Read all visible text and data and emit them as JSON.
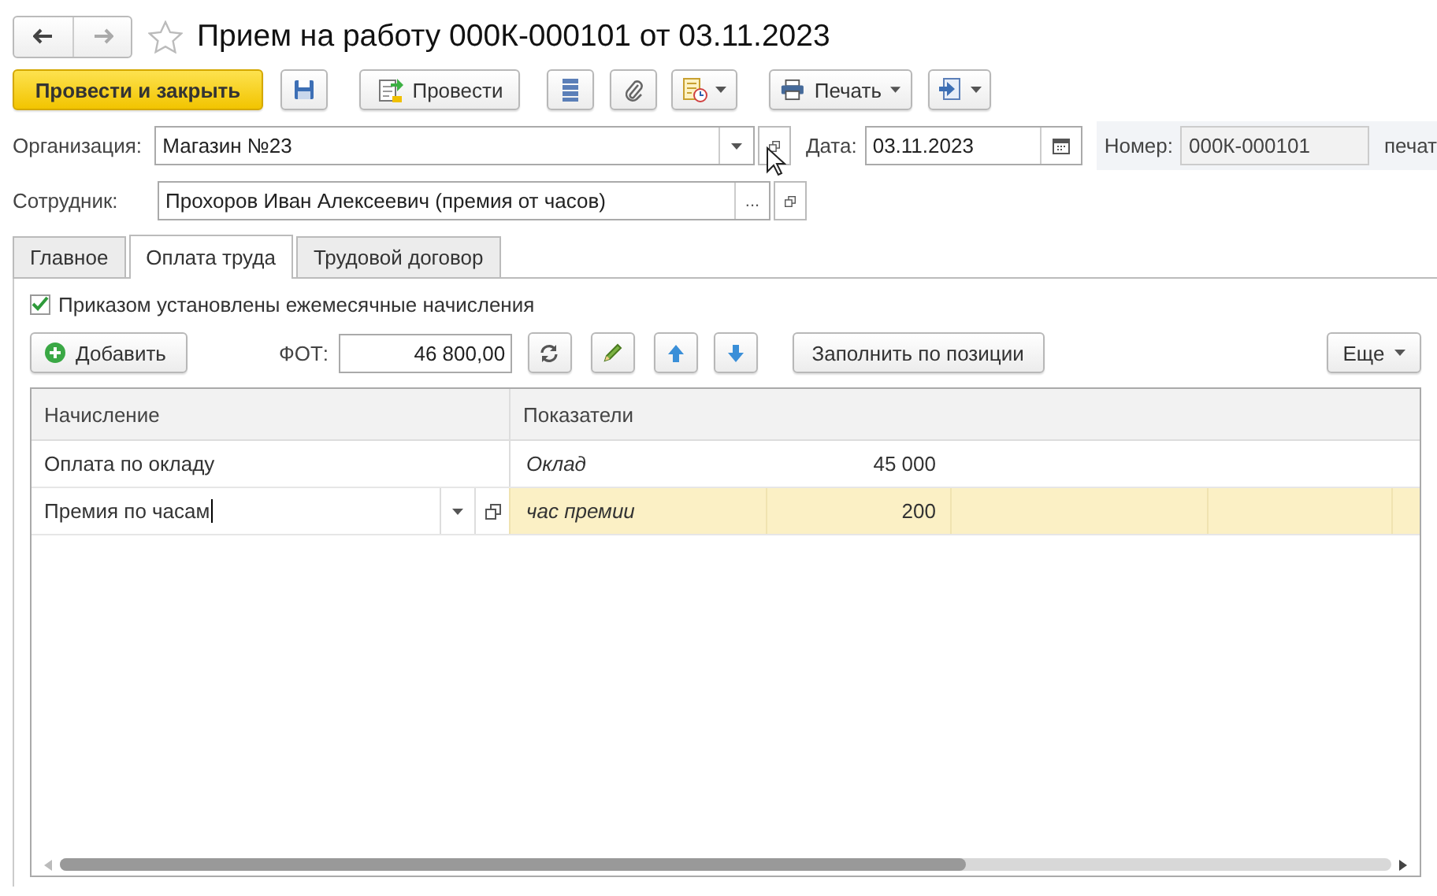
{
  "window": {
    "title": "Прием на работу 000К-000101 от 03.11.2023"
  },
  "toolbar": {
    "post_and_close": "Провести и закрыть",
    "post": "Провести",
    "print": "Печать"
  },
  "fields": [
    {
      "label": "Организация:",
      "value": "Магазин №23"
    },
    {
      "label": "Сотрудник:",
      "value": "Прохоров Иван Алексеевич (премия от часов)",
      "select_button": "..."
    }
  ],
  "date": {
    "label": "Дата:",
    "value": "03.11.2023"
  },
  "number": {
    "label": "Номер:",
    "value": "000К-000101",
    "cut_label": "печат"
  },
  "tabs": [
    {
      "label": "Главное",
      "selected": false
    },
    {
      "label": "Оплата труда",
      "selected": true
    },
    {
      "label": "Трудовой договор",
      "selected": false
    }
  ],
  "monthly_checkbox": {
    "label": "Приказом установлены ежемесячные начисления",
    "checked": true
  },
  "panel_toolbar": {
    "add": "Добавить",
    "fot_label": "ФОТ:",
    "fot_value": "46 800,00",
    "fill": "Заполнить по позиции",
    "more": "Еще"
  },
  "table": {
    "columns": [
      "Начисление",
      "Показатели"
    ],
    "rows": [
      {
        "accrual": "Оплата по окладу",
        "indicator": "Оклад",
        "value": "45 000",
        "selected": false
      },
      {
        "accrual": "Премия по часам",
        "indicator": "час премии",
        "value": "200",
        "selected": true
      }
    ]
  }
}
